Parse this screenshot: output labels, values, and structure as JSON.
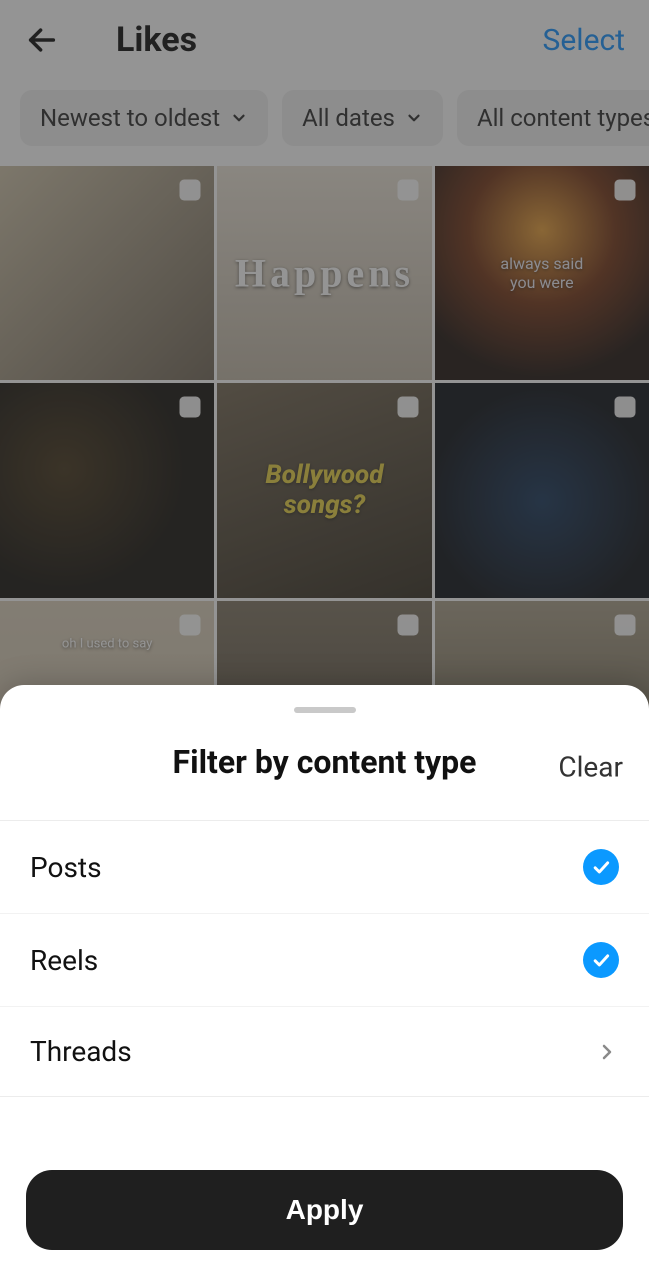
{
  "header": {
    "title": "Likes",
    "select_label": "Select"
  },
  "chips": {
    "sort": "Newest to oldest",
    "date": "All dates",
    "type": "All content types"
  },
  "grid": {
    "c2_text": "Happens",
    "c3_text": "always said you were",
    "c5_text": "Bollywood songs?",
    "c7_text": "oh I used to say"
  },
  "sheet": {
    "title": "Filter by content type",
    "clear_label": "Clear",
    "options": [
      {
        "label": "Posts"
      },
      {
        "label": "Reels"
      },
      {
        "label": "Threads"
      }
    ],
    "apply_label": "Apply"
  }
}
